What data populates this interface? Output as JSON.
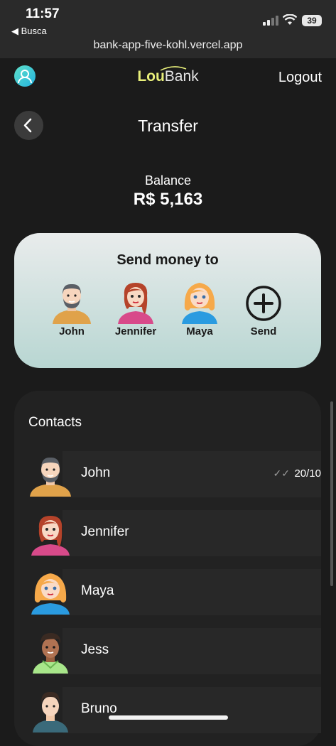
{
  "status": {
    "time": "11:57",
    "back_app": "◀ Busca",
    "url": "bank-app-five-kohl.vercel.app",
    "battery": "39"
  },
  "header": {
    "logo_part1": "Lou",
    "logo_part2": "Bank",
    "logout_label": "Logout"
  },
  "page": {
    "title": "Transfer",
    "balance_label": "Balance",
    "balance_amount": "R$ 5,163"
  },
  "send_card": {
    "title": "Send money to",
    "quick": [
      {
        "name": "John"
      },
      {
        "name": "Jennifer"
      },
      {
        "name": "Maya"
      }
    ],
    "send_label": "Send"
  },
  "contacts": {
    "title": "Contacts",
    "items": [
      {
        "name": "John",
        "date": "20/10",
        "checks": "✓✓"
      },
      {
        "name": "Jennifer"
      },
      {
        "name": "Maya"
      },
      {
        "name": "Jess"
      },
      {
        "name": "Bruno"
      }
    ]
  },
  "colors": {
    "accent": "#e8ef7a",
    "card_gradient_top": "#e9ecec",
    "card_gradient_bottom": "#b8d6d2",
    "background": "#1b1b1b"
  }
}
